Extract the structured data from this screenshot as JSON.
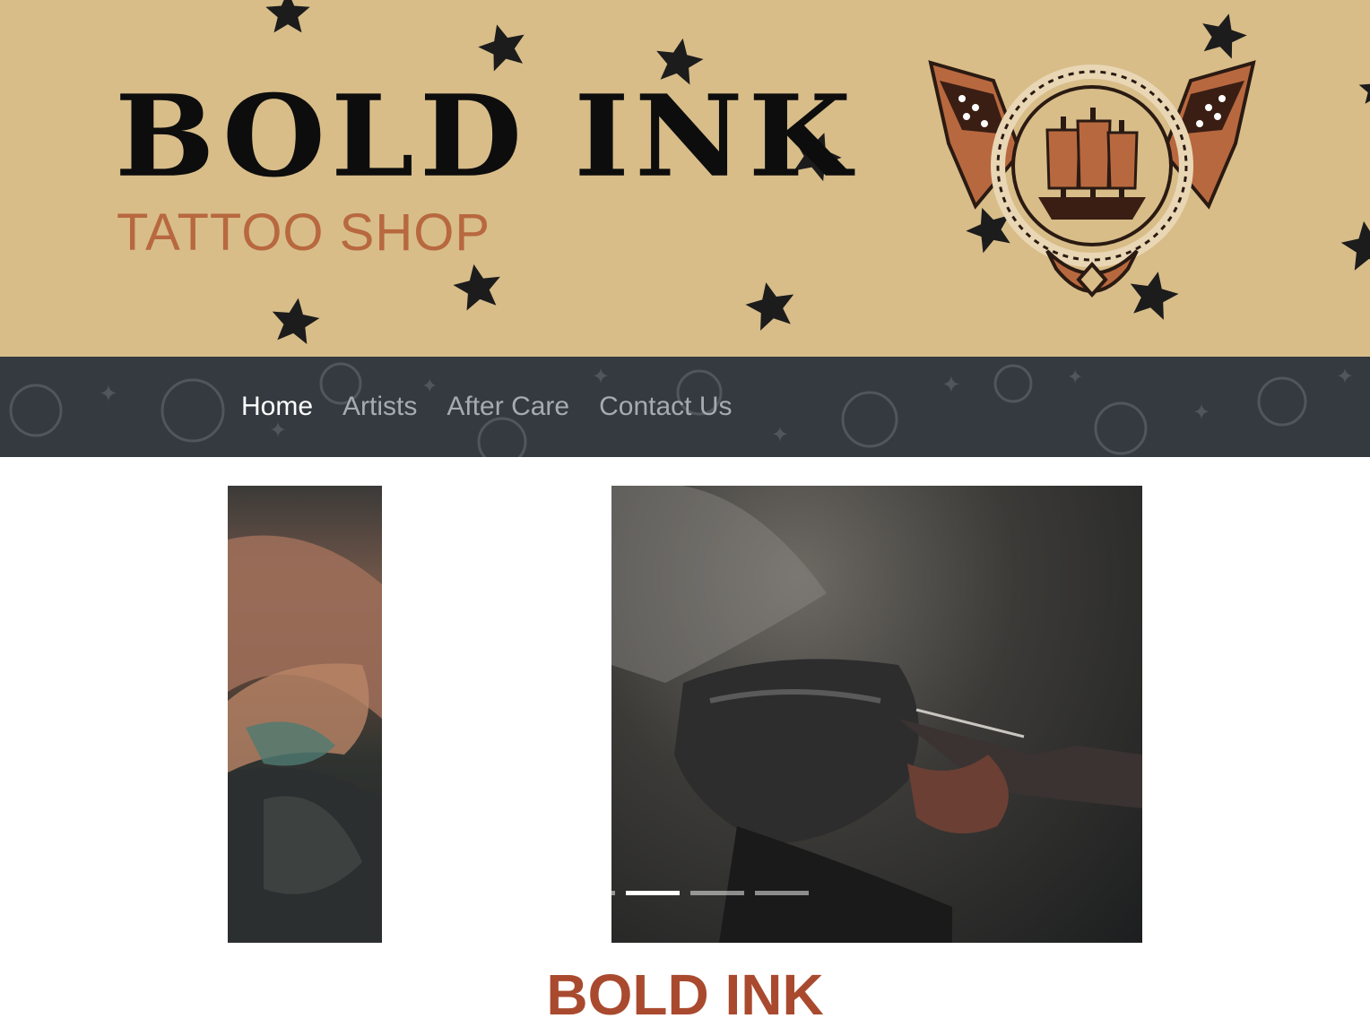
{
  "banner": {
    "logo_title": "BOLD INK",
    "logo_subtitle": "TATTOO SHOP",
    "background_color": "#d8bd89",
    "title_color": "#0d0d0d",
    "subtitle_color": "#b8683f",
    "emblem_icon": "ship-emblem-icon"
  },
  "nav": {
    "background_color": "#343a40",
    "items": [
      {
        "label": "Home",
        "active": true
      },
      {
        "label": "Artists",
        "active": false
      },
      {
        "label": "After Care",
        "active": false
      },
      {
        "label": "Contact Us",
        "active": false
      }
    ]
  },
  "carousel": {
    "slides": [
      "tattoo-arm-photo",
      "tattoo-machine-photo"
    ],
    "indicator_count": 4,
    "active_indicator": 1
  },
  "main": {
    "heading": "BOLD INK",
    "heading_color": "#a94a2f"
  }
}
